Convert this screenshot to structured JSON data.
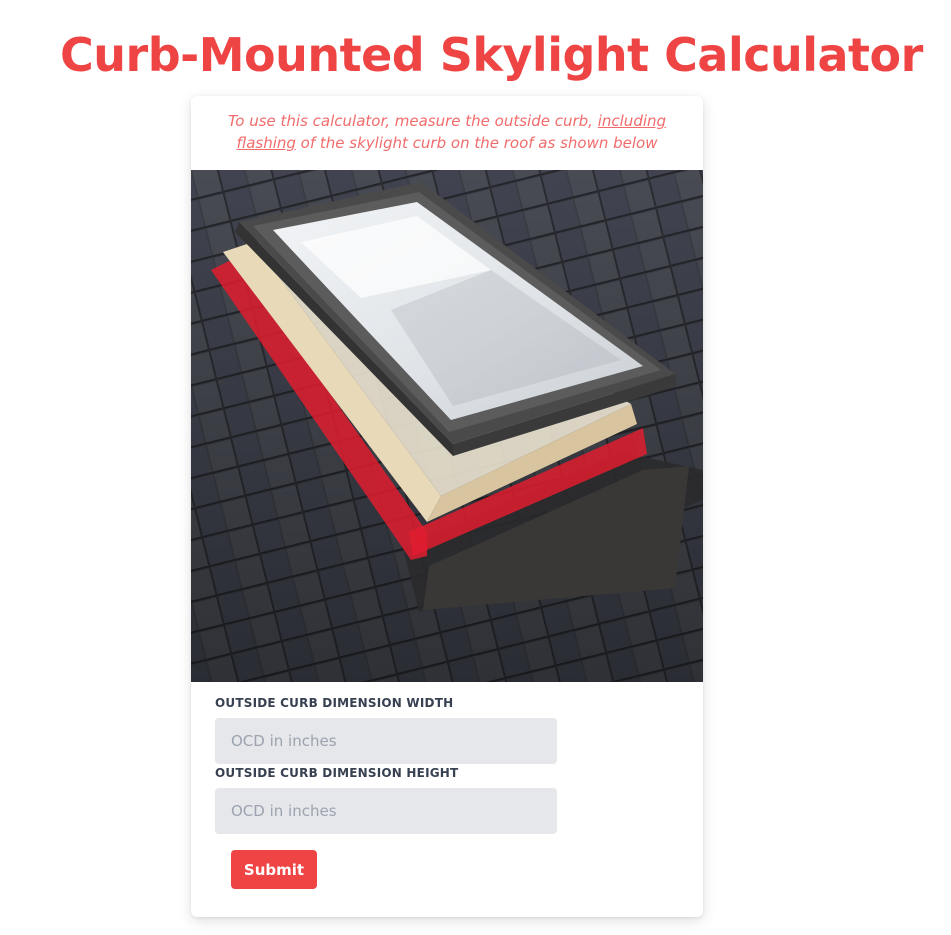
{
  "page": {
    "title": "Curb-Mounted Skylight Calculator"
  },
  "card": {
    "intro": {
      "part1": "To use this calculator, measure the outside curb, ",
      "link1": "including",
      "link2": "flashing",
      "part2": " of the skylight curb on the roof as shown below"
    },
    "image_name": "curb-mounted-skylight-on-shingle-roof",
    "width_field": {
      "label": "OUTSIDE CURB DIMENSION WIDTH",
      "value": "",
      "placeholder": "OCD in inches"
    },
    "height_field": {
      "label": "OUTSIDE CURB DIMENSION HEIGHT",
      "value": "",
      "placeholder": "OCD in inches"
    },
    "submit_label": "Submit"
  },
  "colors": {
    "accent": "#ef4444",
    "intro_text": "#f26b6b",
    "input_bg": "#e5e7eb",
    "curb_highlight": "#e11d2f"
  }
}
